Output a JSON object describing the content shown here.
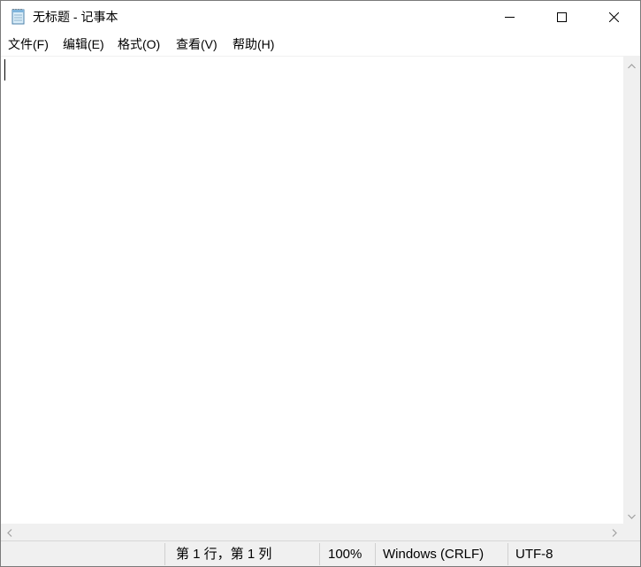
{
  "window": {
    "title": "无标题 - 记事本"
  },
  "menubar": {
    "items": [
      {
        "label": "文件(F)"
      },
      {
        "label": "编辑(E)"
      },
      {
        "label": "格式(O)"
      },
      {
        "label": "查看(V)"
      },
      {
        "label": "帮助(H)"
      }
    ]
  },
  "editor": {
    "content": ""
  },
  "statusbar": {
    "position": "第 1 行，第 1 列",
    "zoom": "100%",
    "line_ending": "Windows (CRLF)",
    "encoding": "UTF-8"
  },
  "icons": {
    "app": "notepad-icon",
    "minimize": "minimize-icon",
    "maximize": "maximize-icon",
    "close": "close-icon"
  },
  "colors": {
    "statusbar_bg": "#f0f0f0",
    "scrollbar_bg": "#f0f0f0",
    "window_border": "#7a7a7a"
  }
}
